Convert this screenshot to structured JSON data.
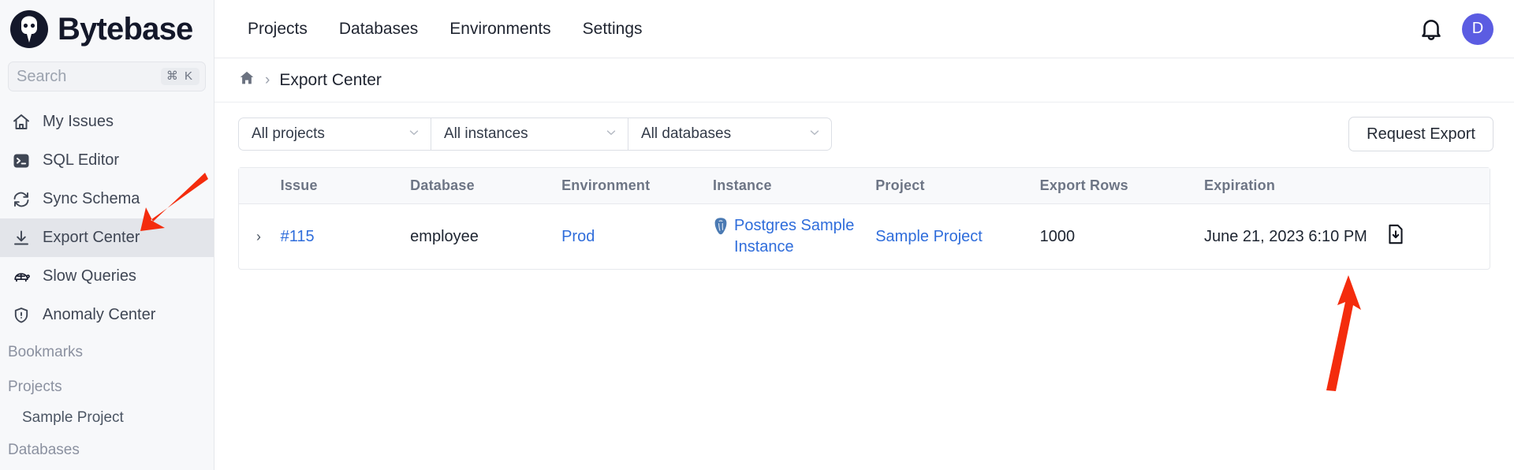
{
  "brand": {
    "name": "Bytebase",
    "logo_icon": "bytebase-logo-icon"
  },
  "sidebar": {
    "search": {
      "placeholder": "Search",
      "shortcut": "⌘ K"
    },
    "items": [
      {
        "label": "My Issues",
        "icon": "home-icon"
      },
      {
        "label": "SQL Editor",
        "icon": "terminal-icon"
      },
      {
        "label": "Sync Schema",
        "icon": "refresh-icon"
      },
      {
        "label": "Export Center",
        "icon": "download-icon",
        "active": true
      },
      {
        "label": "Slow Queries",
        "icon": "turtle-icon"
      },
      {
        "label": "Anomaly Center",
        "icon": "shield-alert-icon"
      }
    ],
    "groups": [
      {
        "label": "Bookmarks",
        "children": []
      },
      {
        "label": "Projects",
        "children": [
          "Sample Project"
        ]
      },
      {
        "label": "Databases",
        "children": []
      }
    ]
  },
  "topbar": {
    "nav": [
      "Projects",
      "Databases",
      "Environments",
      "Settings"
    ],
    "bell_icon": "bell-icon",
    "avatar_initial": "D",
    "avatar_color": "#5b5ce2"
  },
  "breadcrumb": {
    "home_icon": "home-icon",
    "separator": "›",
    "current": "Export Center"
  },
  "filters": {
    "project": {
      "value": "All projects",
      "caret": "chevron-down-icon"
    },
    "instance": {
      "value": "All instances",
      "caret": "chevron-down-icon"
    },
    "database": {
      "value": "All databases",
      "caret": "chevron-down-icon"
    },
    "request_export_label": "Request Export"
  },
  "table": {
    "columns": [
      "",
      "Issue",
      "Database",
      "Environment",
      "Instance",
      "Project",
      "Export Rows",
      "Expiration",
      ""
    ],
    "rows": [
      {
        "expand": "›",
        "issue": "#115",
        "database": "employee",
        "environment": "Prod",
        "instance": "Postgres Sample Instance",
        "instance_icon": "postgres-icon",
        "project": "Sample Project",
        "export_rows": "1000",
        "expiration": "June 21, 2023 6:10 PM",
        "action_icon": "file-download-icon"
      }
    ]
  },
  "annotations": [
    {
      "name": "arrow-to-export-center",
      "color": "#f42c0d"
    },
    {
      "name": "arrow-to-download-action",
      "color": "#f42c0d"
    }
  ]
}
